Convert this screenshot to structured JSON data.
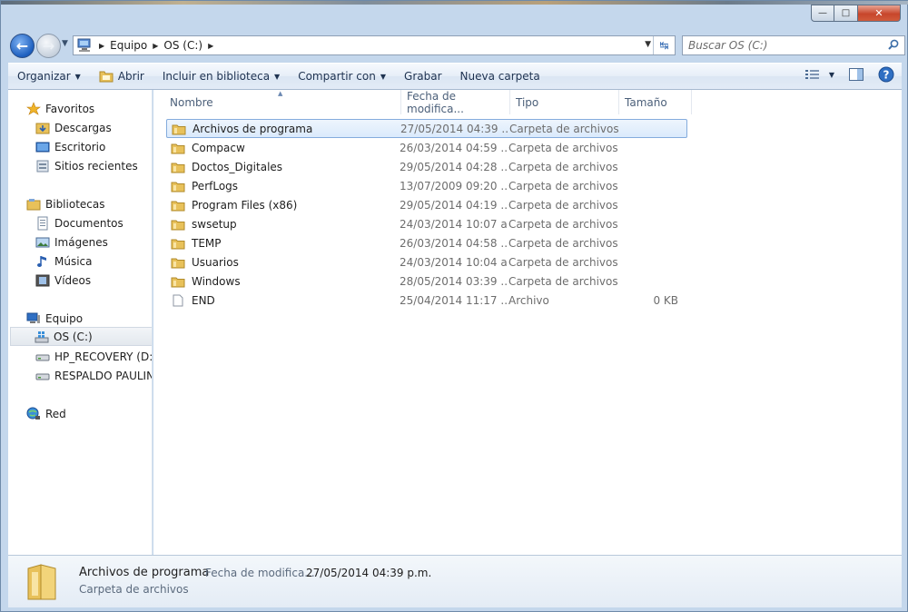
{
  "address": {
    "crumbs": [
      "Equipo",
      "OS (C:)"
    ]
  },
  "search": {
    "placeholder": "Buscar OS (C:)"
  },
  "toolbar": {
    "organize": "Organizar",
    "open": "Abrir",
    "include": "Incluir en biblioteca",
    "share": "Compartir con",
    "burn": "Grabar",
    "new_folder": "Nueva carpeta"
  },
  "sidebar": {
    "favorites": "Favoritos",
    "downloads": "Descargas",
    "desktop": "Escritorio",
    "recent": "Sitios recientes",
    "libraries": "Bibliotecas",
    "documents": "Documentos",
    "images": "Imágenes",
    "music": "Música",
    "videos": "Vídeos",
    "computer": "Equipo",
    "drive_c": "OS (C:)",
    "drive_d": "HP_RECOVERY (D:)",
    "drive_e": "RESPALDO PAULINA",
    "network": "Red"
  },
  "columns": {
    "name": "Nombre",
    "date": "Fecha de modifica...",
    "type": "Tipo",
    "size": "Tamaño"
  },
  "files": [
    {
      "name": "Archivos de programa",
      "date": "27/05/2014 04:39 ...",
      "type": "Carpeta de archivos",
      "size": "",
      "kind": "folder"
    },
    {
      "name": "Compacw",
      "date": "26/03/2014 04:59 ...",
      "type": "Carpeta de archivos",
      "size": "",
      "kind": "folder"
    },
    {
      "name": "Doctos_Digitales",
      "date": "29/05/2014 04:28 ...",
      "type": "Carpeta de archivos",
      "size": "",
      "kind": "folder"
    },
    {
      "name": "PerfLogs",
      "date": "13/07/2009 09:20 ...",
      "type": "Carpeta de archivos",
      "size": "",
      "kind": "folder"
    },
    {
      "name": "Program Files (x86)",
      "date": "29/05/2014 04:19 ...",
      "type": "Carpeta de archivos",
      "size": "",
      "kind": "folder"
    },
    {
      "name": "swsetup",
      "date": "24/03/2014 10:07 a...",
      "type": "Carpeta de archivos",
      "size": "",
      "kind": "folder"
    },
    {
      "name": "TEMP",
      "date": "26/03/2014 04:58 ...",
      "type": "Carpeta de archivos",
      "size": "",
      "kind": "folder"
    },
    {
      "name": "Usuarios",
      "date": "24/03/2014 10:04 a...",
      "type": "Carpeta de archivos",
      "size": "",
      "kind": "folder"
    },
    {
      "name": "Windows",
      "date": "28/05/2014 03:39 ...",
      "type": "Carpeta de archivos",
      "size": "",
      "kind": "folder"
    },
    {
      "name": "END",
      "date": "25/04/2014 11:17 ...",
      "type": "Archivo",
      "size": "0 KB",
      "kind": "file"
    }
  ],
  "details": {
    "name": "Archivos de programa",
    "date_label": "Fecha de modifica...",
    "date_value": "27/05/2014 04:39 p.m.",
    "type": "Carpeta de archivos"
  },
  "colors": {
    "accent": "#1d5fbf",
    "selection": "#dbeafc",
    "folder": "#e8c15a"
  }
}
